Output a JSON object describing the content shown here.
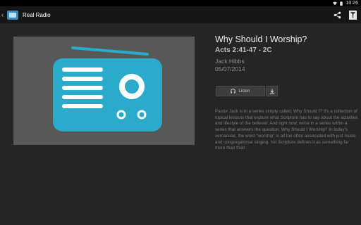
{
  "status_bar": {
    "time": "10:26"
  },
  "action_bar": {
    "title": "Real Radio"
  },
  "sermon": {
    "title": "Why Should I Worship?",
    "passage": "Acts 2:41-47 - 2C",
    "speaker": "Jack Hibbs",
    "date": "05/07/2014",
    "listen_label": "Listen",
    "description": "Pastor Jack is in a series simply called, Why Should I? It's a collection of topical lessons that explore what Scripture has to say about the activities and lifestyle of the believer. And right now, we're in a series within a series that answers the question, Why Should I Worship? In today's vernacular, the word \"worship\" is all too often associated with just music and congregational singing. Yet Scripture defines it as something far more than that!"
  },
  "colors": {
    "radio_teal": "#2aabcc",
    "artwork_bg": "#585858",
    "background": "#252525",
    "action_bar": "#161616"
  },
  "icons": [
    "back-chevron-icon",
    "app-logo-icon",
    "share-icon",
    "filter-icon",
    "headphones-icon",
    "download-icon",
    "wifi-icon",
    "battery-icon",
    "radio-icon"
  ]
}
